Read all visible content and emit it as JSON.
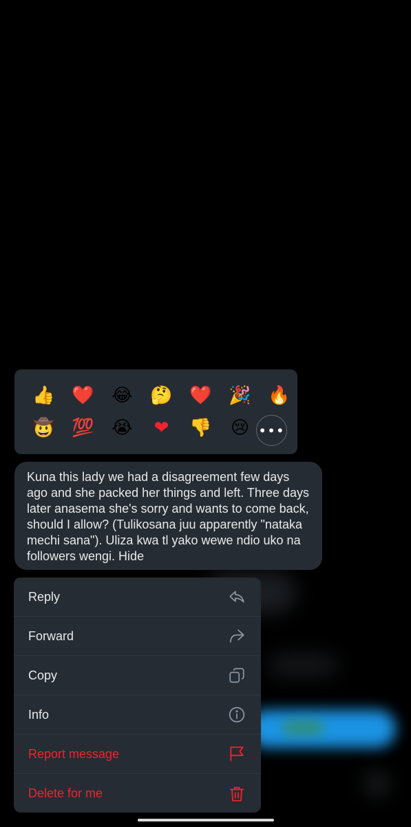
{
  "reactions": {
    "row1": [
      {
        "emoji": "👍",
        "name": "thumbs-up"
      },
      {
        "emoji": "❤️",
        "name": "red-heart"
      },
      {
        "emoji": "😂",
        "name": "face-with-tears-of-joy"
      },
      {
        "emoji": "🤔",
        "name": "thinking-face"
      },
      {
        "emoji": "❤️",
        "name": "red-heart-2"
      },
      {
        "emoji": "🎉",
        "name": "party-popper"
      },
      {
        "emoji": "🔥",
        "name": "fire"
      }
    ],
    "row2": [
      {
        "emoji": "🤠",
        "name": "cowboy-face"
      },
      {
        "emoji": "💯",
        "name": "hundred-points"
      },
      {
        "emoji": "😭",
        "name": "loudly-crying-face"
      },
      {
        "emoji": "❤",
        "name": "heart-suit"
      },
      {
        "emoji": "👎",
        "name": "thumbs-down"
      },
      {
        "emoji": "😢",
        "name": "crying-face"
      }
    ],
    "more_label": "•••"
  },
  "message": {
    "text": "Kuna this lady we had a disagreement few days ago and she packed her things and left. Three days later anasema she's sorry and wants to come back, should I allow? (Tulikosana juu apparently \"nataka mechi sana\"). Uliza kwa tl yako wewe ndio uko na followers wengi. Hide"
  },
  "menu": {
    "items": [
      {
        "label": "Reply",
        "icon": "reply-icon",
        "danger": false
      },
      {
        "label": "Forward",
        "icon": "forward-icon",
        "danger": false
      },
      {
        "label": "Copy",
        "icon": "copy-icon",
        "danger": false
      },
      {
        "label": "Info",
        "icon": "info-icon",
        "danger": false
      },
      {
        "label": "Report message",
        "icon": "flag-icon",
        "danger": true
      },
      {
        "label": "Delete for me",
        "icon": "trash-icon",
        "danger": true
      }
    ]
  },
  "colors": {
    "background": "#000000",
    "surface": "#262c33",
    "text": "#e7e9ea",
    "danger": "#f4212e",
    "icon": "#8b98a5"
  }
}
